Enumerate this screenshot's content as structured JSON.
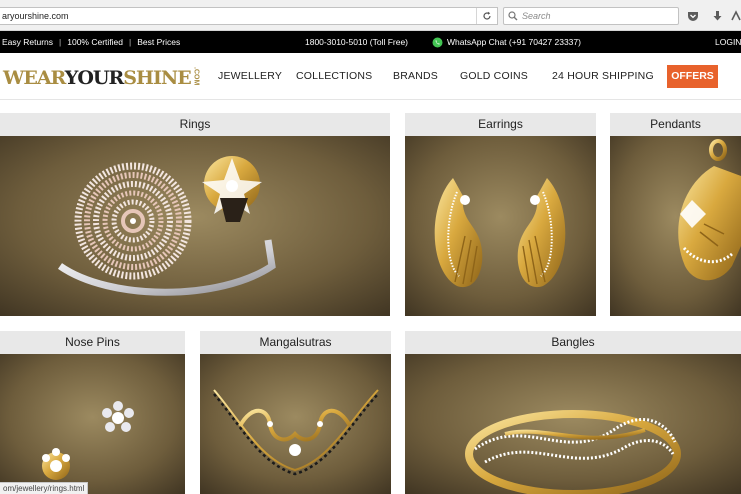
{
  "browser": {
    "url": "aryourshine.com",
    "search_placeholder": "Search"
  },
  "topbar": {
    "easy_returns": "Easy Returns",
    "certified": "100% Certified",
    "best_prices": "Best Prices",
    "phone": "1800-3010-5010 (Toll Free)",
    "whatsapp": "WhatsApp Chat (+91 70427 23337)",
    "login": "LOGIN"
  },
  "logo": {
    "wear": "WEAR",
    "your": "YOUR",
    "shine": "SHINE",
    "com": ".COM"
  },
  "nav": {
    "items": [
      "JEWELLERY",
      "COLLECTIONS",
      "BRANDS",
      "GOLD COINS",
      "24 HOUR SHIPPING"
    ],
    "offers": "OFFERS"
  },
  "tiles": {
    "rings": "Rings",
    "earrings": "Earrings",
    "pendants": "Pendants",
    "nose_pins": "Nose Pins",
    "mangalsutras": "Mangalsutras",
    "bangles": "Bangles"
  },
  "status_url": "om/jewellery/rings.html",
  "colors": {
    "accent": "#e8622c",
    "brand_gold": "#a98d42",
    "tile_header": "#e8e8e8",
    "backdrop": "#7a6a48"
  }
}
